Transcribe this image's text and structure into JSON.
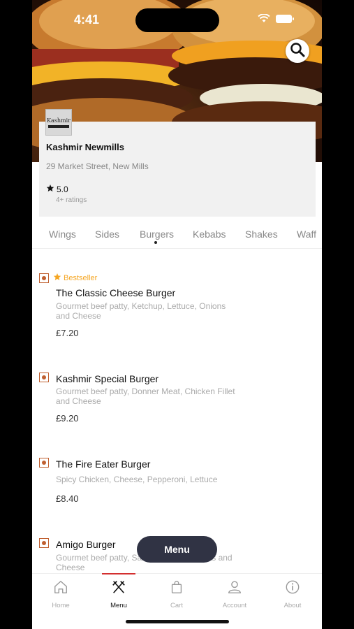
{
  "status_bar": {
    "time": "4:41"
  },
  "restaurant": {
    "logo_text": "Kashmir",
    "name": "Kashmir Newmills",
    "address": "29 Market Street, New Mills",
    "rating": "5.0",
    "rating_count": "4+ ratings"
  },
  "categories": [
    "Wings",
    "Sides",
    "Burgers",
    "Kebabs",
    "Shakes",
    "Waff"
  ],
  "active_category": "Burgers",
  "menu_items": [
    {
      "badge": "Bestseller",
      "name": "The Classic Cheese Burger",
      "description": "Gourmet beef patty, Ketchup, Lettuce, Onions and Cheese",
      "price": "£7.20"
    },
    {
      "badge": "",
      "name": "Kashmir Special Burger",
      "description": "Gourmet beef patty, Donner Meat, Chicken Fillet and Cheese",
      "price": "£9.20"
    },
    {
      "badge": "",
      "name": "The Fire Eater Burger",
      "description": "Spicy Chicken, Cheese, Pepperoni, Lettuce",
      "price": "£8.40"
    },
    {
      "badge": "",
      "name": "Amigo Burger",
      "description": "Gourmet beef patty, Salsa, Lettuce ,Onions and Cheese",
      "price": ""
    }
  ],
  "floating_button": {
    "label": "Menu"
  },
  "tabbar": [
    {
      "label": "Home",
      "icon": "home-icon"
    },
    {
      "label": "Menu",
      "icon": "fork-knife-icon"
    },
    {
      "label": "Cart",
      "icon": "bag-icon"
    },
    {
      "label": "Account",
      "icon": "person-icon"
    },
    {
      "label": "About",
      "icon": "info-icon"
    }
  ],
  "active_tab": "Menu",
  "colors": {
    "accent": "#d32f2f",
    "veg_marker": "#c06030",
    "bestseller": "#f5a623",
    "floating_button": "#303344"
  }
}
